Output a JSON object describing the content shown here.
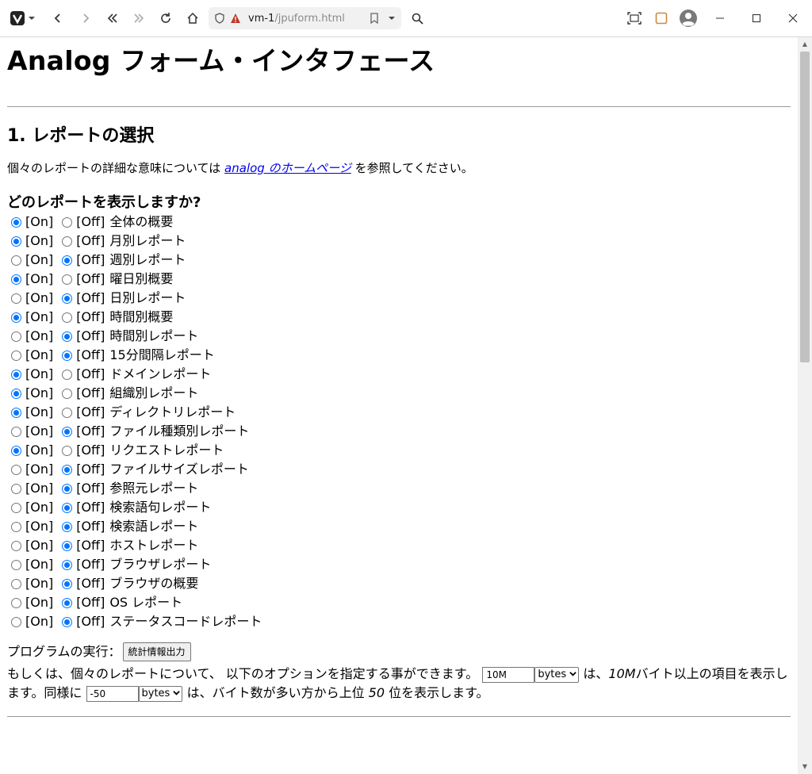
{
  "browser": {
    "address_host": "vm-1",
    "address_path": "/jpuform.html",
    "icons": [
      "vivaldi-logo-icon",
      "back-icon",
      "forward-icon",
      "rewind-icon",
      "fast-forward-icon",
      "reload-icon",
      "home-icon",
      "shield-icon",
      "warning-icon",
      "bookmark-icon",
      "dropdown-icon",
      "search-icon",
      "capture-icon",
      "panel-icon",
      "profile-icon",
      "minimize-icon",
      "maximize-icon",
      "close-icon"
    ],
    "accent": "#c0392b"
  },
  "page": {
    "title": "Analog フォーム・インタフェース",
    "section_heading": "1. レポートの選択",
    "intro_before": "個々のレポートの詳細な意味については",
    "intro_link": "analog のホームページ",
    "intro_after": "を参照してください。",
    "question": "どのレポートを表示しますか?",
    "on_label": "[On]",
    "off_label": "[Off]",
    "reports": [
      {
        "name": "全体の概要",
        "on": true
      },
      {
        "name": "月別レポート",
        "on": true
      },
      {
        "name": "週別レポート",
        "on": false
      },
      {
        "name": "曜日別概要",
        "on": true
      },
      {
        "name": "日別レポート",
        "on": false
      },
      {
        "name": "時間別概要",
        "on": true
      },
      {
        "name": "時間別レポート",
        "on": false
      },
      {
        "name": "15分間隔レポート",
        "on": false
      },
      {
        "name": "ドメインレポート",
        "on": true
      },
      {
        "name": "組織別レポート",
        "on": true
      },
      {
        "name": "ディレクトリレポート",
        "on": true
      },
      {
        "name": "ファイル種類別レポート",
        "on": false
      },
      {
        "name": "リクエストレポート",
        "on": true
      },
      {
        "name": "ファイルサイズレポート",
        "on": false
      },
      {
        "name": "参照元レポート",
        "on": false
      },
      {
        "name": "検索語句レポート",
        "on": false
      },
      {
        "name": "検索語レポート",
        "on": false
      },
      {
        "name": "ホストレポート",
        "on": false
      },
      {
        "name": "ブラウザレポート",
        "on": false
      },
      {
        "name": "ブラウザの概要",
        "on": false
      },
      {
        "name": "OS レポート",
        "on": false
      },
      {
        "name": "ステータスコードレポート",
        "on": false
      }
    ],
    "run_label": "プログラムの実行：",
    "run_button": "統計情報出力",
    "option_text_1": "もしくは、個々のレポートについて、 以下のオプションを指定する事ができます。",
    "option_value_1": "10M",
    "option_unit_1": "bytes",
    "option_text_2a": "は、",
    "option_em_1": "10M",
    "option_text_2b": "バイト以上の項目を表示します。同様に",
    "option_value_2": "-50",
    "option_unit_2": "bytes",
    "option_text_3a": "は、バイト数が多い方から上位",
    "option_em_2": "50",
    "option_text_3b": "位を表示します。"
  }
}
